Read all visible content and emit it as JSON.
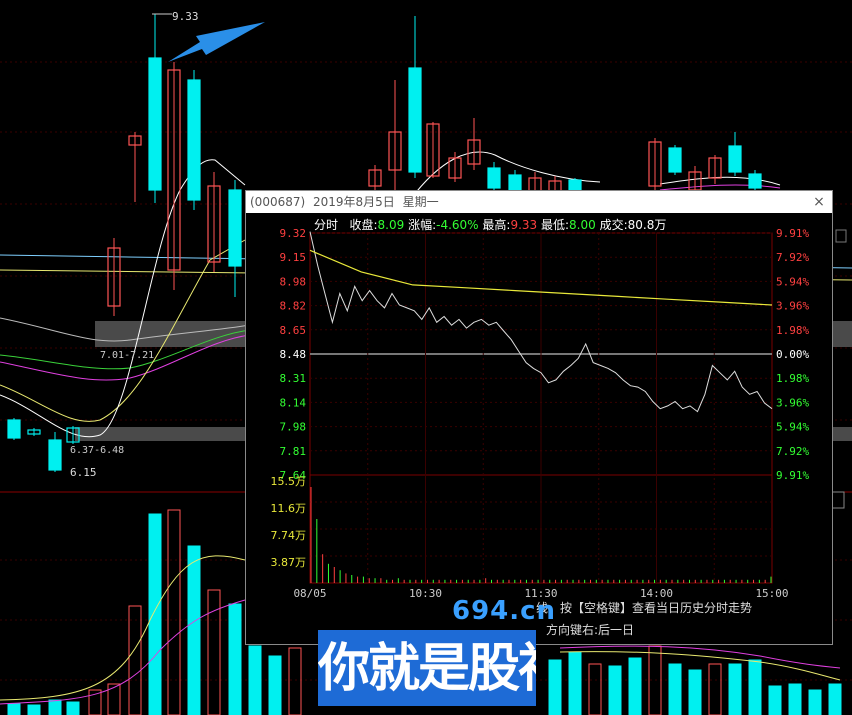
{
  "main_chart": {
    "high_label": "9.33",
    "low_label": "6.15",
    "range_label_1": "7.01-7.21",
    "range_label_2": "6.37-6.48"
  },
  "popup": {
    "title_code": "(000687)",
    "title_date": "2019年8月5日",
    "title_weekday": "星期一",
    "close_glyph": "×",
    "info": {
      "mode": "分时",
      "close_label": "收盘:",
      "close_value": "8.09",
      "change_label": "涨幅:",
      "change_value": "-4.60%",
      "high_label": "最高:",
      "high_value": "9.33",
      "low_label": "最低:",
      "low_value": "8.00",
      "volume_label": "成交:",
      "volume_value": "80.8万"
    },
    "price_axis": [
      "9.32",
      "9.15",
      "8.98",
      "8.82",
      "8.65",
      "8.48",
      "8.31",
      "8.14",
      "7.98",
      "7.81",
      "7.64"
    ],
    "pct_axis": [
      "9.91%",
      "7.92%",
      "5.94%",
      "3.96%",
      "1.98%",
      "0.00%",
      "1.98%",
      "3.96%",
      "5.94%",
      "7.92%",
      "9.91%"
    ],
    "volume_axis": [
      "15.5万",
      "11.6万",
      "7.74万",
      "3.87万"
    ],
    "time_axis": [
      "08/05",
      "10:30",
      "11:30",
      "14:00",
      "15:00"
    ],
    "hint_line_1": "线，按【空格键】查看当日历史分时走势",
    "hint_line_2": "方向键右:后一日",
    "colors": {
      "up": "#ff4040",
      "down": "#33ff33",
      "neutral": "#ffffff",
      "avg_line": "#e8e83a",
      "volume_axis": "#e8e83a"
    }
  },
  "watermark": {
    "site": "694.cn",
    "slogan": "你就是股神"
  }
}
